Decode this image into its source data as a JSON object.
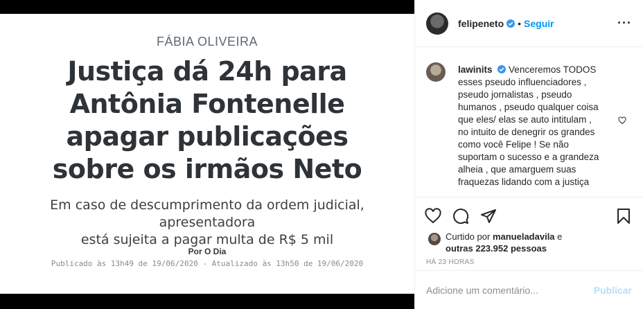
{
  "post_image": {
    "columnist": "FÁBIA OLIVEIRA",
    "headline": [
      "Justiça dá 24h para",
      "Antônia Fontenelle",
      "apagar publicações",
      "sobre os irmãos Neto"
    ],
    "subhead": [
      "Em caso de descumprimento da ordem judicial, apresentadora",
      "está sujeita a pagar multa de R$ 5 mil"
    ],
    "byline": "Por O Dia",
    "dates": "Publicado às 13h49 de 19/06/2020 - Atualizado às 13h50 de 19/06/2020"
  },
  "header": {
    "username": "felipeneto",
    "separator": "•",
    "follow_label": "Seguir",
    "more_label": "···"
  },
  "comment": {
    "username": "lawinits",
    "text": "Venceremos TODOS esses pseudo influenciadores , pseudo jornalistas , pseudo humanos , pseudo qualquer coisa que eles/ elas se auto intitulam , no intuito de denegrir os grandes como você Felipe ! Se não suportam o sucesso e a grandeza alheia , que amarguem suas fraquezas lidando com a justiça"
  },
  "likes": {
    "prefix": "Curtido por",
    "user": "manueladavila",
    "connector": "e",
    "others": "outras 223.952 pessoas"
  },
  "timestamp": "HÁ 23 HORAS",
  "add_comment": {
    "placeholder": "Adicione um comentário...",
    "publish_label": "Publicar"
  },
  "colors": {
    "link_blue": "#0095f6",
    "publish_disabled": "#b2dffc",
    "verified_blue": "#3897f0"
  }
}
